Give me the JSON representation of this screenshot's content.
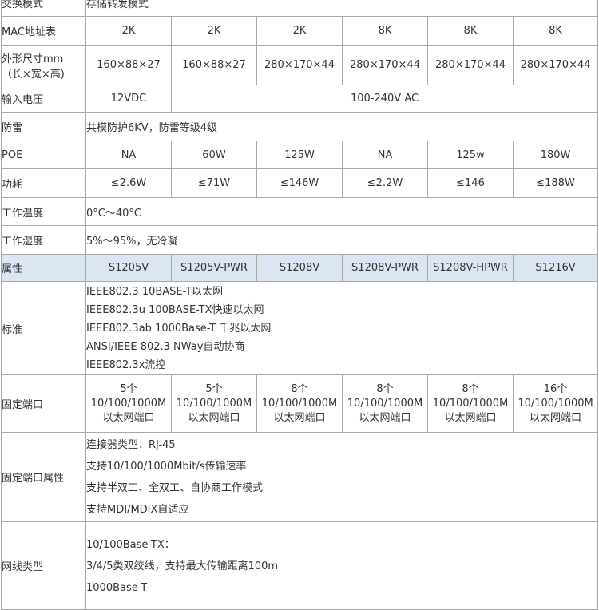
{
  "rows": {
    "exchange_mode": {
      "label": "交换模式",
      "value": "存储转发模式"
    },
    "mac": {
      "label": "MAC地址表",
      "values": [
        "2K",
        "2K",
        "2K",
        "8K",
        "8K",
        "8K"
      ]
    },
    "size": {
      "label_line1": "外形尺寸mm",
      "label_line2": "（长×宽×高)",
      "values": [
        "160×88×27",
        "160×88×27",
        "280×170×44",
        "280×170×44",
        "280×170×44",
        "280×170×44"
      ]
    },
    "voltage": {
      "label": "输入电压",
      "value_a": "12VDC",
      "value_b": "100-240V AC"
    },
    "lightning": {
      "label": "防雷",
      "value": "共模防护6KV，防雷等级4级"
    },
    "poe": {
      "label": "POE",
      "values": [
        "NA",
        "60W",
        "125W",
        "NA",
        "125w",
        "180W"
      ]
    },
    "power": {
      "label": "功耗",
      "values": [
        "≤2.6W",
        "≤71W",
        "≤146W",
        "≤2.2W",
        "≤146",
        "≤188W"
      ]
    },
    "temp": {
      "label": "工作温度",
      "value": "0°C～40°C"
    },
    "humidity": {
      "label": "工作湿度",
      "value": "5%～95%，无冷凝"
    },
    "attribute": {
      "label": "属性",
      "values": [
        "S1205V",
        "S1205V-PWR",
        "S1208V",
        "S1208V-PWR",
        "S1208V-HPWR",
        "S1216V"
      ]
    },
    "standard": {
      "label": "标准",
      "lines": [
        "IEEE802.3 10BASE-T以太网",
        "IEEE802.3u 100BASE-TX快速以太网",
        "IEEE802.3ab 1000Base-T 千兆以太网",
        "ANSI/IEEE 802.3 NWay自动协商",
        "IEEE802.3x流控"
      ]
    },
    "fixed_ports": {
      "label": "固定端口",
      "items": [
        {
          "count": "5个",
          "speed": "10/100/1000M",
          "type": "以太网端口"
        },
        {
          "count": "5个",
          "speed": "10/100/1000M",
          "type": "以太网端口"
        },
        {
          "count": "8个",
          "speed": "10/100/1000M",
          "type": "以太网端口"
        },
        {
          "count": "8个",
          "speed": "10/100/1000M",
          "type": "以太网端口"
        },
        {
          "count": "8个",
          "speed": "10/100/1000M",
          "type": "以太网端口"
        },
        {
          "count": "16个",
          "speed": "10/100/1000M",
          "type": "以太网端口"
        }
      ]
    },
    "port_attr": {
      "label": "固定端口属性",
      "lines": [
        "连接器类型：RJ-45",
        "支持10/100/1000Mbit/s传输速率",
        "支持半双工、全双工、自协商工作模式",
        "支持MDI/MDIX自适应"
      ]
    },
    "cable": {
      "label": "网线类型",
      "lines": [
        "10/100Base-TX：",
        "3/4/5类双绞线，支持最大传输距离100m",
        "1000Base-T"
      ]
    }
  }
}
